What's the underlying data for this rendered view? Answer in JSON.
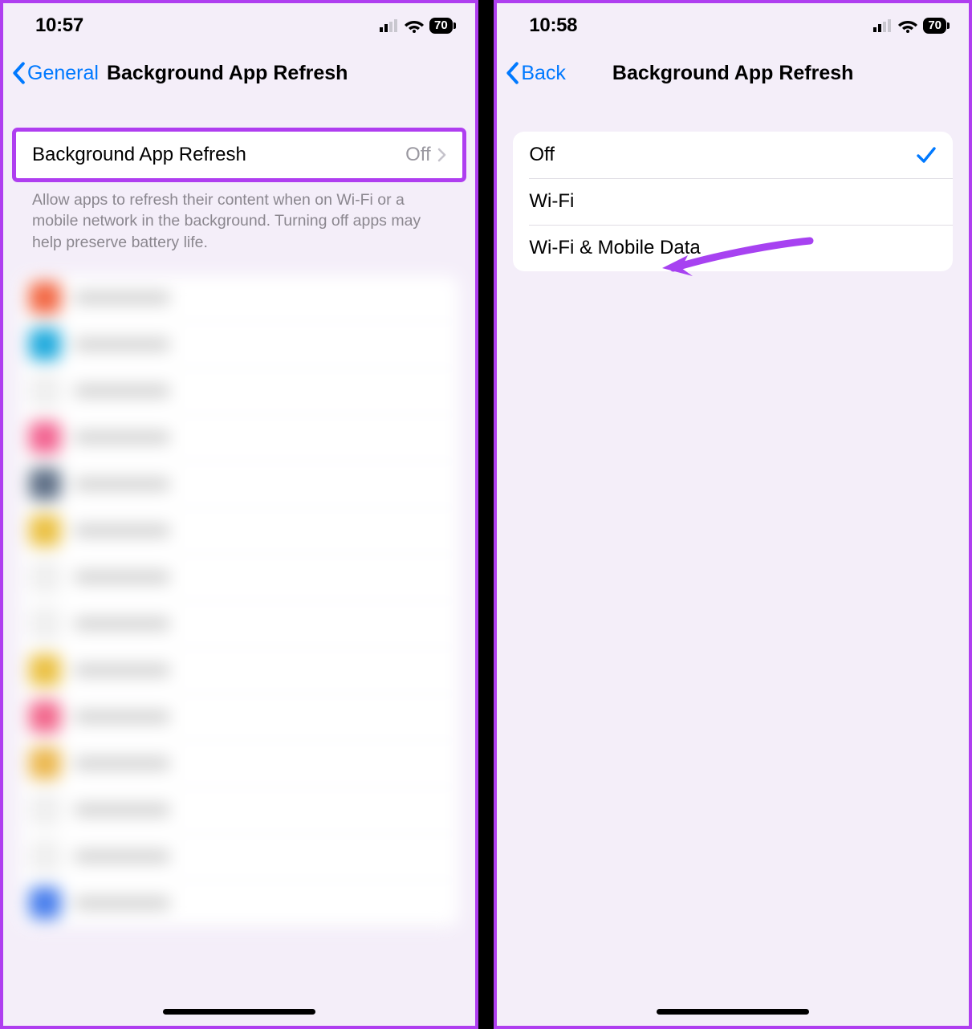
{
  "left": {
    "status": {
      "time": "10:57",
      "battery": "70"
    },
    "nav": {
      "back_label": "General",
      "title": "Background App Refresh"
    },
    "master_cell": {
      "label": "Background App Refresh",
      "value": "Off"
    },
    "footer": "Allow apps to refresh their content when on Wi-Fi or a mobile network in the background. Turning off apps may help preserve battery life.",
    "blurred_colors": [
      "#e86a4a",
      "#2aa8d6",
      "#efefef",
      "#e8668f",
      "#5f6f84",
      "#e7c14f",
      "#efefef",
      "#efefef",
      "#e7c14f",
      "#e86a8c",
      "#e7b85a",
      "#efefef",
      "#efefef",
      "#4d7ee2"
    ]
  },
  "right": {
    "status": {
      "time": "10:58",
      "battery": "70"
    },
    "nav": {
      "back_label": "Back",
      "title": "Background App Refresh"
    },
    "options": [
      {
        "label": "Off",
        "checked": true
      },
      {
        "label": "Wi-Fi",
        "checked": false
      },
      {
        "label": "Wi-Fi & Mobile Data",
        "checked": false
      }
    ]
  },
  "annotations": {
    "arrow_color": "#a742f1"
  }
}
